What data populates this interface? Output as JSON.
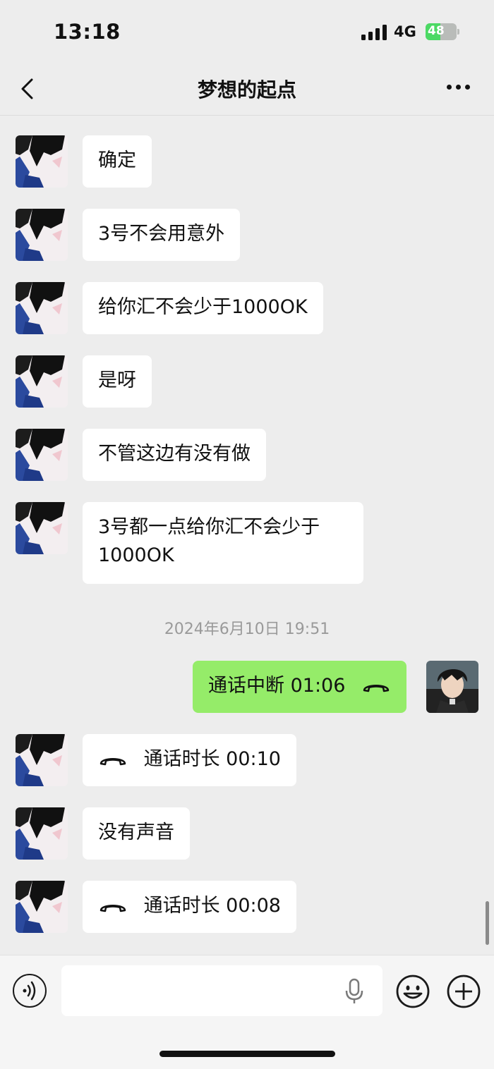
{
  "status_bar": {
    "time": "13:18",
    "network": "4G",
    "battery": "48",
    "battery_level": 0.48
  },
  "header": {
    "title": "梦想的起点"
  },
  "messages": [
    {
      "side": "in",
      "text": "确定"
    },
    {
      "side": "in",
      "text": "3号不会用意外"
    },
    {
      "side": "in",
      "text": "给你汇不会少于1000OK"
    },
    {
      "side": "in",
      "text": "是呀"
    },
    {
      "side": "in",
      "text": "不管这边有没有做"
    },
    {
      "side": "in",
      "text": "3号都一点给你汇不会少于1000OK"
    },
    {
      "timestamp": "2024年6月10日 19:51"
    },
    {
      "side": "out",
      "type": "call",
      "text": "通话中断 01:06"
    },
    {
      "side": "in",
      "type": "call",
      "text": "通话时长 00:10"
    },
    {
      "side": "in",
      "text": "没有声音"
    },
    {
      "side": "in",
      "type": "call",
      "text": "通话时长 00:08"
    }
  ],
  "input": {
    "placeholder": ""
  },
  "icons": {
    "back": "back-chevron-icon",
    "more": "more-dots-icon",
    "call": "phone-hangup-icon",
    "voice": "voice-icon",
    "mic": "microphone-icon",
    "emoji": "emoji-icon",
    "plus": "plus-icon"
  },
  "colors": {
    "background": "#ededed",
    "incoming_bubble": "#ffffff",
    "outgoing_bubble": "#95ec69",
    "battery": "#4cd964"
  }
}
